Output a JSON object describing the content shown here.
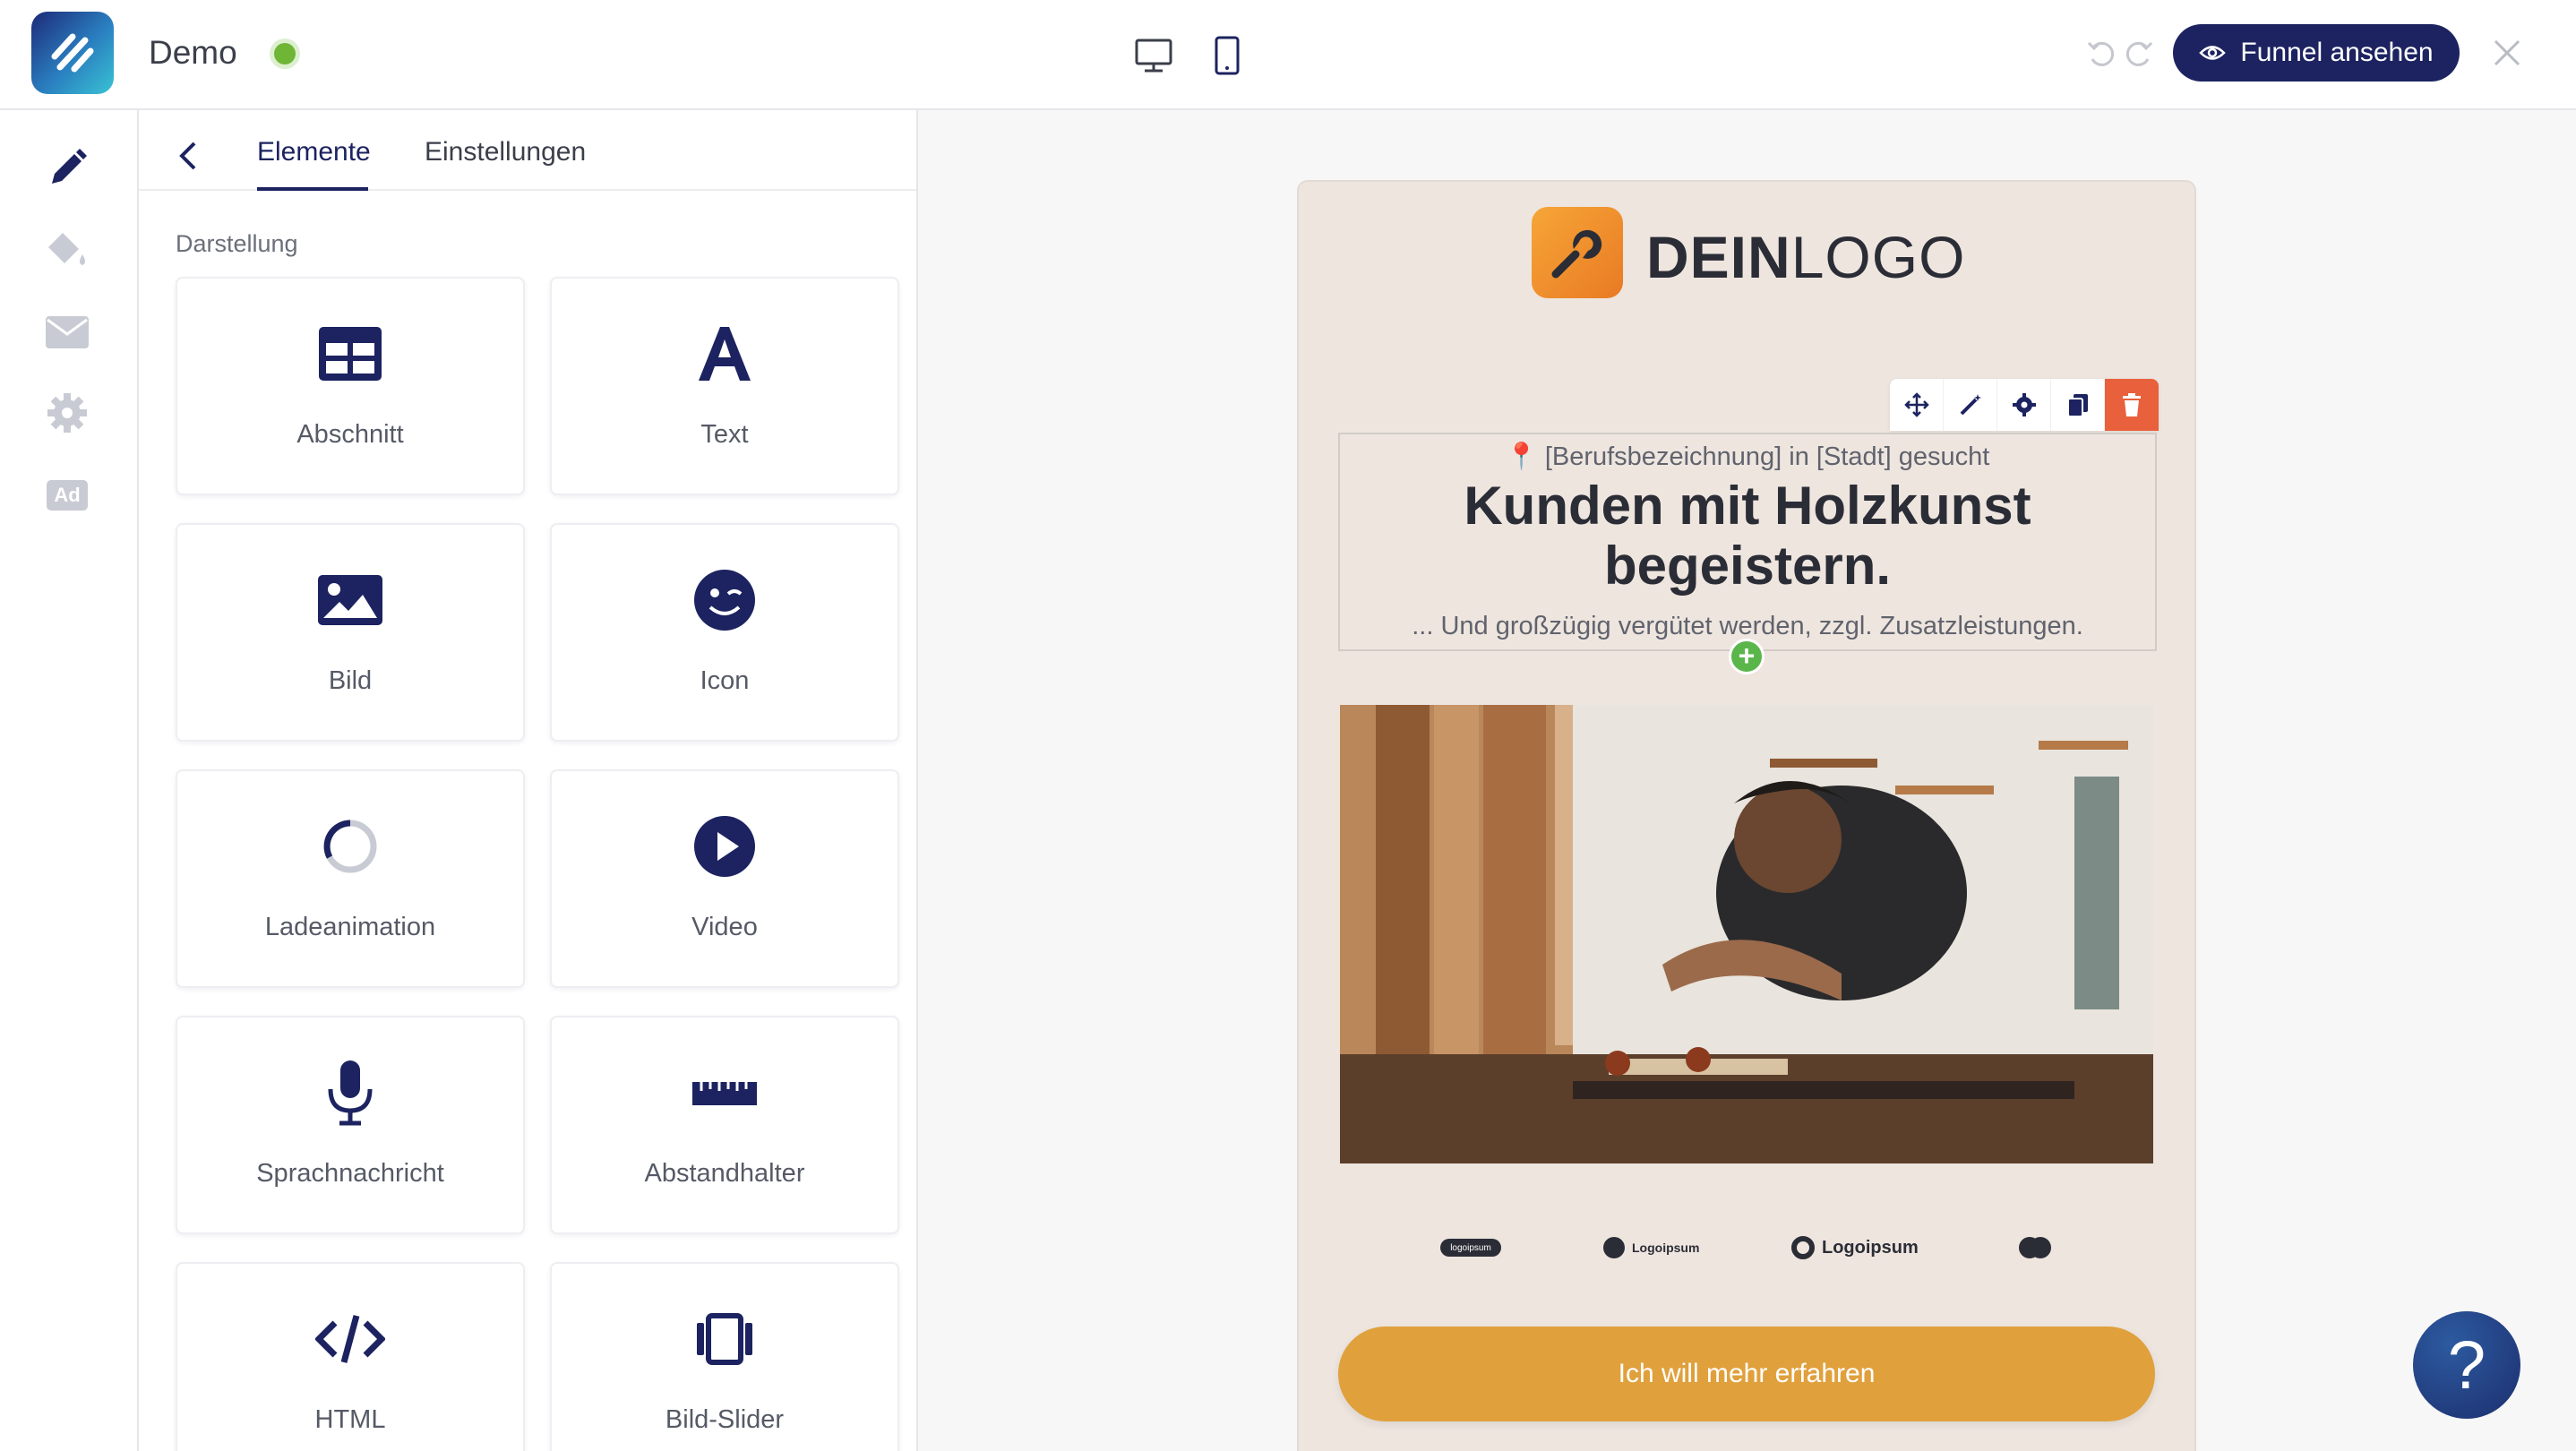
{
  "header": {
    "project_name": "Demo",
    "status_color": "#6fb536",
    "devices": [
      "desktop-icon",
      "mobile-icon"
    ],
    "funnel_button_label": "Funnel ansehen",
    "close_icon": "close-icon"
  },
  "rail": {
    "items": [
      "pencil-icon",
      "paint-bucket-icon",
      "mail-icon",
      "gear-icon",
      "ad-icon"
    ],
    "ad_label": "Ad"
  },
  "panel": {
    "tabs": [
      {
        "label": "Elemente",
        "active": true
      },
      {
        "label": "Einstellungen",
        "active": false
      }
    ],
    "section_label": "Darstellung",
    "elements": [
      {
        "label": "Abschnitt",
        "icon": "section-grid-icon"
      },
      {
        "label": "Text",
        "icon": "text-a-icon"
      },
      {
        "label": "Bild",
        "icon": "image-icon"
      },
      {
        "label": "Icon",
        "icon": "wink-smiley-icon"
      },
      {
        "label": "Ladeanimation",
        "icon": "loader-icon"
      },
      {
        "label": "Video",
        "icon": "play-circle-icon"
      },
      {
        "label": "Sprachnachricht",
        "icon": "microphone-icon"
      },
      {
        "label": "Abstandhalter",
        "icon": "ruler-icon"
      },
      {
        "label": "HTML",
        "icon": "code-icon"
      },
      {
        "label": "Bild-Slider",
        "icon": "image-slider-icon"
      }
    ]
  },
  "preview": {
    "brand": {
      "bold": "DEIN",
      "light": "LOGO"
    },
    "element_tools": [
      "move-icon",
      "magic-wand-icon",
      "gear-icon",
      "copy-icon",
      "trash-icon"
    ],
    "job_line": "[Berufsbezeichnung] in [Stadt] gesucht",
    "headline": "Kunden mit Holzkunst begeistern.",
    "subline": "... Und großzügig vergütet werden, zzgl. Zusatzleistungen.",
    "logos": [
      "logoipsum",
      "Logoipsum",
      "Logoipsum"
    ],
    "cta_label": "Ich will mehr erfahren",
    "accent_color": "#e0a03c"
  },
  "help": {
    "label": "?"
  }
}
